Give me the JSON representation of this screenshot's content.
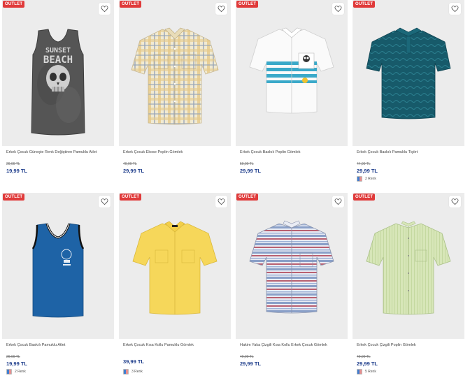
{
  "products": [
    {
      "badge": "OUTLET",
      "name": "Erkek Çocuk Güneşte Renk Değiştiren Pamuklu Atlet",
      "old_price": "29,99 TL",
      "price": "19,99 TL",
      "colors": "",
      "swatch": []
    },
    {
      "badge": "OUTLET",
      "name": "Erkek Çocuk Ekose Poplin Gömlek",
      "old_price": "49,99 TL",
      "price": "29,99 TL",
      "colors": "",
      "swatch": []
    },
    {
      "badge": "OUTLET",
      "name": "Erkek Çocuk Baskılı Poplin Gömlek",
      "old_price": "59,99 TL",
      "price": "29,99 TL",
      "colors": "",
      "swatch": []
    },
    {
      "badge": "OUTLET",
      "name": "Erkek Çocuk Baskılı Pamuklu Tişört",
      "old_price": "44,99 TL",
      "price": "29,99 TL",
      "colors": "2 Renk",
      "swatch": [
        "#3f7fd1",
        "#e88f8f"
      ]
    },
    {
      "badge": "OUTLET",
      "name": "Erkek Çocuk Baskılı Pamuklu Atlet",
      "old_price": "29,99 TL",
      "price": "19,99 TL",
      "colors": "2 Renk",
      "swatch": [
        "#3f7fd1",
        "#e88f8f"
      ]
    },
    {
      "badge": "OUTLET",
      "name": "Erkek Çocuk Kısa Kollu Pamuklu Gömlek",
      "old_price": "",
      "price": "39,99 TL",
      "colors": "3 Renk",
      "swatch": [
        "#3f7fd1",
        "#e88f8f"
      ]
    },
    {
      "badge": "OUTLET",
      "name": "Hakim Yaka Çizgili Kısa Kollu Erkek Çocuk Gömlek",
      "old_price": "49,99 TL",
      "price": "29,99 TL",
      "colors": "",
      "swatch": []
    },
    {
      "badge": "OUTLET",
      "name": "Erkek Çocuk Çizgili Poplin Gömlek",
      "old_price": "49,99 TL",
      "price": "29,99 TL",
      "colors": "5 Renk",
      "swatch": [
        "#3f7fd1",
        "#e88f8f"
      ]
    }
  ],
  "print_text": {
    "line1": "SUNSET",
    "line2": "BEACH"
  },
  "colors": {
    "price": "#1f3e8c",
    "badge": "#e03a3a"
  }
}
